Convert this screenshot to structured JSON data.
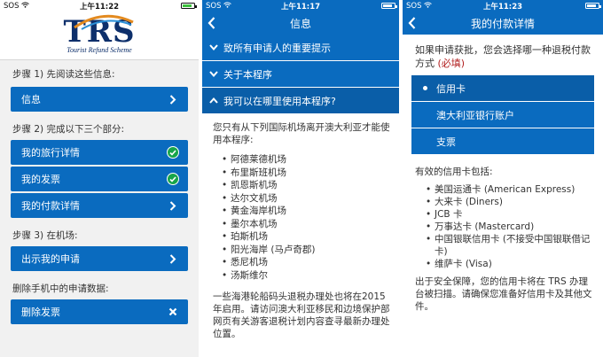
{
  "colors": {
    "brand_blue": "#0a6bbf",
    "check_green": "#17a54a",
    "required_red": "#b22020",
    "logo_navy": "#0d2f6b"
  },
  "screen1": {
    "status": {
      "carrier": "SOS",
      "time": "上午11:22"
    },
    "logo": {
      "text": "TRS",
      "subtitle": "Tourist Refund Scheme"
    },
    "step1": {
      "label": "步骤 1) 先阅读这些信息:",
      "buttons": [
        {
          "label": "信息",
          "icon": "chevron-right-icon"
        }
      ]
    },
    "step2": {
      "label": "步骤 2) 完成以下三个部分:",
      "buttons": [
        {
          "label": "我的旅行详情",
          "icon": "check-circle-icon"
        },
        {
          "label": "我的发票",
          "icon": "check-circle-icon"
        },
        {
          "label": "我的付款详情",
          "icon": "chevron-right-icon"
        }
      ]
    },
    "step3": {
      "label": "步骤 3) 在机场:",
      "buttons": [
        {
          "label": "出示我的申请",
          "icon": "chevron-right-icon"
        }
      ]
    },
    "delete": {
      "label": "删除手机中的申请数据:",
      "buttons": [
        {
          "label": "删除发票",
          "icon": "close-icon"
        }
      ]
    }
  },
  "screen2": {
    "status": {
      "carrier": "SOS",
      "time": "上午11:17"
    },
    "title": "信息",
    "accordion": [
      {
        "label": "致所有申请人的重要提示",
        "expanded": false
      },
      {
        "label": "关于本程序",
        "expanded": false
      },
      {
        "label": "我可以在哪里使用本程序?",
        "expanded": true
      }
    ],
    "intro": "您只有从下列国际机场离开澳大利亚才能使用本程序:",
    "airports": [
      "阿德莱德机场",
      "布里斯班机场",
      "凯恩斯机场",
      "达尔文机场",
      "黄金海岸机场",
      "墨尔本机场",
      "珀斯机场",
      "阳光海岸 (马卢奇郡)",
      "悉尼机场",
      "汤斯维尔"
    ],
    "footer": "一些海港轮船码头退税办理处也将在2015年启用。请访问澳大利亚移民和边境保护部网页有关游客退税计划内容查寻最新办理处位置。"
  },
  "screen3": {
    "status": {
      "carrier": "SOS",
      "time": "上午11:23"
    },
    "title": "我的付款详情",
    "intro": "如果申请获批，您会选择哪一种退税付款方式",
    "required": "(必填)",
    "options": [
      {
        "label": "信用卡",
        "selected": true
      },
      {
        "label": "澳大利亚银行账户",
        "selected": false
      },
      {
        "label": "支票",
        "selected": false
      }
    ],
    "valid_cards_label": "有效的信用卡包括:",
    "cards": [
      "美国运通卡 (American Express)",
      "大来卡 (Diners)",
      "JCB 卡",
      "万事达卡 (Mastercard)",
      "中国银联信用卡 (不接受中国银联借记卡)",
      "维萨卡 (Visa)"
    ],
    "security_note": "出于安全保障，您的信用卡将在 TRS 办理台被扫描。请确保您准备好信用卡及其他文件。"
  }
}
